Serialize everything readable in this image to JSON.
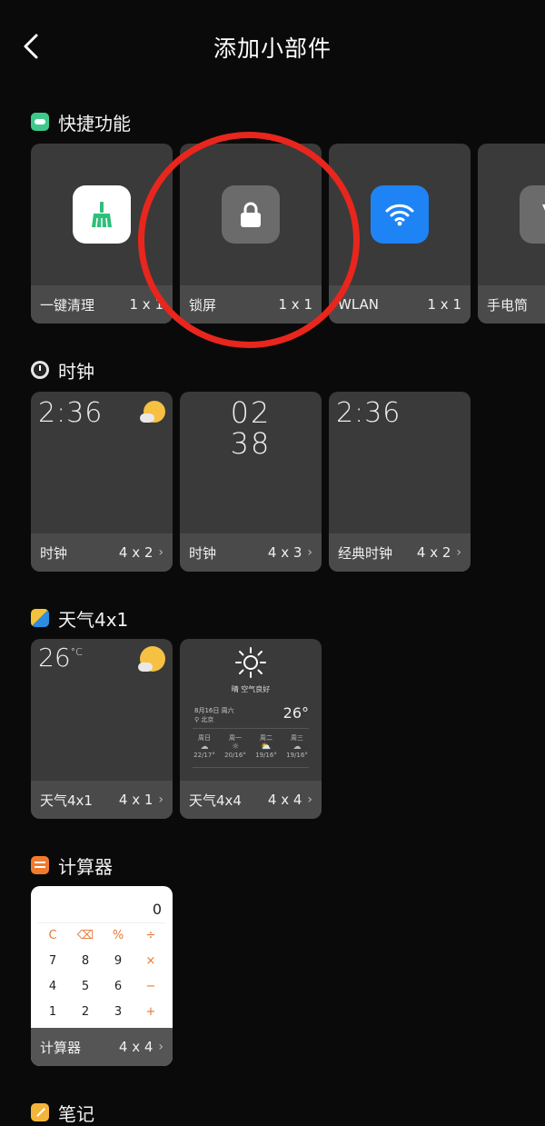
{
  "header": {
    "title": "添加小部件",
    "back_icon": "chevron-left-icon"
  },
  "sections": {
    "quick": {
      "label": "快捷功能",
      "icon_color": "#3ec98a",
      "items": [
        {
          "name": "一键清理",
          "size": "1 x 1",
          "icon": "broom-icon",
          "icon_bg": "#ffffff",
          "icon_color": "#2fbf7a"
        },
        {
          "name": "锁屏",
          "size": "1 x 1",
          "icon": "lock-icon",
          "icon_bg": "#6b6b6b"
        },
        {
          "name": "WLAN",
          "size": "1 x 1",
          "icon": "wifi-icon",
          "icon_bg": "#1e84f5"
        },
        {
          "name": "手电筒",
          "size": "",
          "icon": "flashlight-icon",
          "icon_bg": "#6b6b6b"
        }
      ]
    },
    "clock": {
      "label": "时钟",
      "items": [
        {
          "name": "时钟",
          "size": "4 x 2",
          "time": "2:36"
        },
        {
          "name": "时钟",
          "size": "4 x 3",
          "hour": "02",
          "minute": "38"
        },
        {
          "name": "经典时钟",
          "size": "4 x 2",
          "time": "2:36"
        }
      ]
    },
    "weather": {
      "label": "天气4x1",
      "items": [
        {
          "name": "天气4x1",
          "size": "4 x 1",
          "temp": "26",
          "unit": "°C"
        },
        {
          "name": "天气4x4",
          "size": "4 x 4",
          "condition": "晴  空气良好",
          "date": "8月16日 周六",
          "temp": "26°",
          "location": "北京",
          "forecast": [
            {
              "day": "周日",
              "range": "22/17°"
            },
            {
              "day": "周一",
              "range": "20/16°"
            },
            {
              "day": "周二",
              "range": "19/16°"
            },
            {
              "day": "周三",
              "range": "19/16°"
            }
          ]
        }
      ]
    },
    "calculator": {
      "label": "计算器",
      "items": [
        {
          "name": "计算器",
          "size": "4 x 4",
          "display": "0",
          "keys": [
            "C",
            "⌫",
            "%",
            "÷",
            "7",
            "8",
            "9",
            "×",
            "4",
            "5",
            "6",
            "−",
            "1",
            "2",
            "3",
            "+"
          ]
        }
      ]
    },
    "notes": {
      "label": "笔记"
    }
  },
  "colors": {
    "background": "#0a0a0a",
    "card": "#3a3a3a",
    "card_footer": "#4a4a4a",
    "highlight_circle": "#e8261d"
  }
}
